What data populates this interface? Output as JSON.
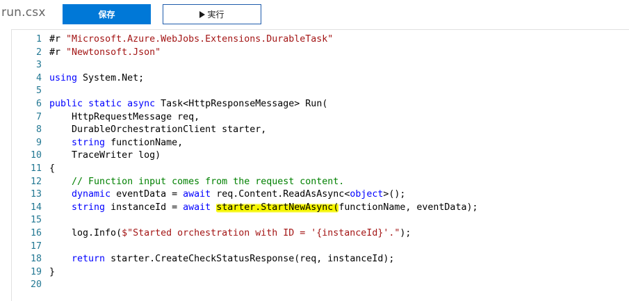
{
  "file": {
    "name": "run.csx"
  },
  "toolbar": {
    "save_label": "保存",
    "run_label": "実行"
  },
  "colors": {
    "save_bg": "#0078d7",
    "run_border": "#1e5bab",
    "keyword": "#0000ff",
    "string": "#a31515",
    "comment": "#008000",
    "line_number": "#237893",
    "highlight": "#f5f500"
  },
  "editor": {
    "lines": [
      {
        "n": "1",
        "tokens": [
          [
            "#r ",
            ""
          ],
          [
            "\"Microsoft.Azure.WebJobs.Extensions.DurableTask\"",
            "str"
          ]
        ]
      },
      {
        "n": "2",
        "tokens": [
          [
            "#r ",
            ""
          ],
          [
            "\"Newtonsoft.Json\"",
            "str"
          ]
        ]
      },
      {
        "n": "3",
        "tokens": []
      },
      {
        "n": "4",
        "tokens": [
          [
            "using",
            "kw"
          ],
          [
            " System.Net;",
            ""
          ]
        ]
      },
      {
        "n": "5",
        "tokens": []
      },
      {
        "n": "6",
        "tokens": [
          [
            "public",
            "kw"
          ],
          [
            " ",
            ""
          ],
          [
            "static",
            "kw"
          ],
          [
            " ",
            ""
          ],
          [
            "async",
            "kw"
          ],
          [
            " Task<HttpResponseMessage> Run(",
            ""
          ]
        ]
      },
      {
        "n": "7",
        "tokens": [
          [
            "    HttpRequestMessage req,",
            ""
          ]
        ]
      },
      {
        "n": "8",
        "tokens": [
          [
            "    DurableOrchestrationClient starter,",
            ""
          ]
        ]
      },
      {
        "n": "9",
        "tokens": [
          [
            "    ",
            ""
          ],
          [
            "string",
            "kw"
          ],
          [
            " functionName,",
            ""
          ]
        ]
      },
      {
        "n": "10",
        "tokens": [
          [
            "    TraceWriter log)",
            ""
          ]
        ]
      },
      {
        "n": "11",
        "tokens": [
          [
            "{",
            ""
          ]
        ]
      },
      {
        "n": "12",
        "tokens": [
          [
            "    ",
            ""
          ],
          [
            "// Function input comes from the request content.",
            "cm"
          ]
        ]
      },
      {
        "n": "13",
        "tokens": [
          [
            "    ",
            ""
          ],
          [
            "dynamic",
            "kw"
          ],
          [
            " eventData = ",
            ""
          ],
          [
            "await",
            "kw"
          ],
          [
            " req.Content.ReadAsAsync<",
            ""
          ],
          [
            "object",
            "kw"
          ],
          [
            ">();",
            ""
          ]
        ]
      },
      {
        "n": "14",
        "tokens": [
          [
            "    ",
            ""
          ],
          [
            "string",
            "kw"
          ],
          [
            " instanceId = ",
            ""
          ],
          [
            "await",
            "kw"
          ],
          [
            " ",
            ""
          ],
          [
            "starter.StartNewAsync(",
            "hl"
          ],
          [
            "functionName, eventData);",
            ""
          ]
        ]
      },
      {
        "n": "15",
        "tokens": []
      },
      {
        "n": "16",
        "tokens": [
          [
            "    log.Info(",
            ""
          ],
          [
            "$\"Started orchestration with ID = '{instanceId}'.\"",
            "str"
          ],
          [
            ");",
            ""
          ]
        ]
      },
      {
        "n": "17",
        "tokens": []
      },
      {
        "n": "18",
        "tokens": [
          [
            "    ",
            ""
          ],
          [
            "return",
            "kw"
          ],
          [
            " starter.CreateCheckStatusResponse(req, instanceId);",
            ""
          ]
        ]
      },
      {
        "n": "19",
        "tokens": [
          [
            "}",
            ""
          ]
        ]
      },
      {
        "n": "20",
        "tokens": []
      }
    ]
  }
}
